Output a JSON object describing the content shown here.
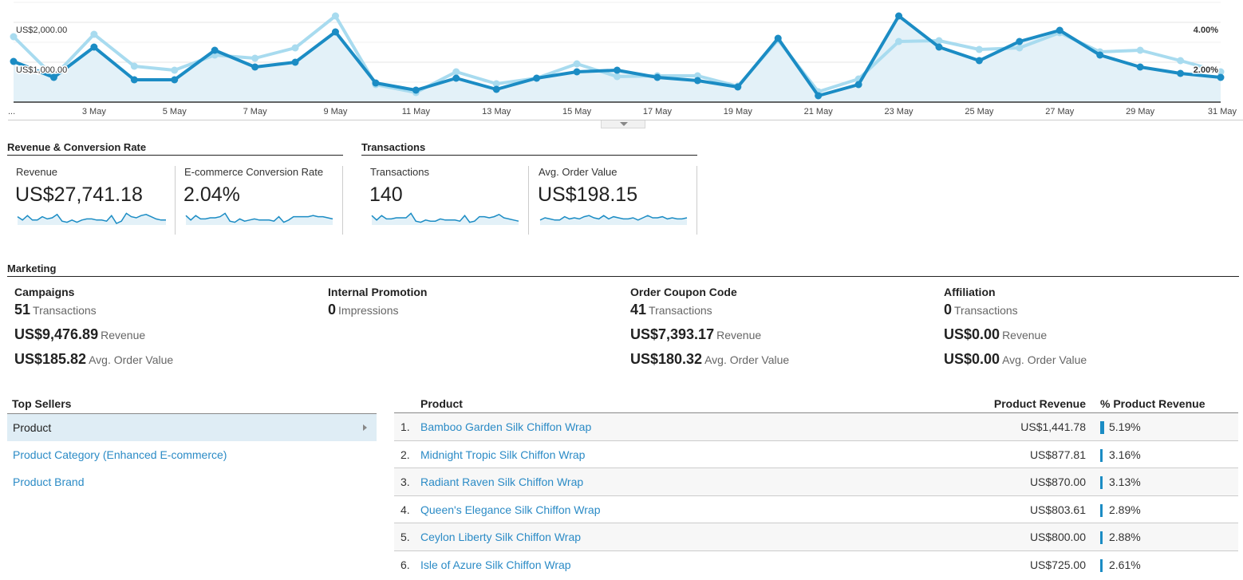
{
  "chart_data": {
    "type": "line",
    "title": "",
    "x": [
      "1 May",
      "2 May",
      "3 May",
      "4 May",
      "5 May",
      "6 May",
      "7 May",
      "8 May",
      "9 May",
      "10 May",
      "11 May",
      "12 May",
      "13 May",
      "14 May",
      "15 May",
      "16 May",
      "17 May",
      "18 May",
      "19 May",
      "20 May",
      "21 May",
      "22 May",
      "23 May",
      "24 May",
      "25 May",
      "26 May",
      "27 May",
      "28 May",
      "29 May",
      "30 May",
      "31 May"
    ],
    "x_tick_labels": [
      "...",
      "3 May",
      "5 May",
      "7 May",
      "9 May",
      "11 May",
      "13 May",
      "15 May",
      "17 May",
      "19 May",
      "21 May",
      "23 May",
      "25 May",
      "27 May",
      "29 May",
      "31 May"
    ],
    "series": [
      {
        "name": "Revenue",
        "axis": "left",
        "color": "#1b8cc4",
        "values": [
          1020,
          620,
          1380,
          560,
          560,
          1300,
          880,
          1000,
          1760,
          480,
          300,
          600,
          320,
          600,
          760,
          800,
          620,
          540,
          380,
          1600,
          160,
          440,
          2160,
          1380,
          1040,
          1520,
          1800,
          1180,
          880,
          720,
          620
        ]
      },
      {
        "name": "E-commerce Conversion Rate",
        "axis": "right",
        "color": "#a8dbef",
        "values": [
          3.28,
          1.28,
          3.4,
          1.8,
          1.6,
          2.36,
          2.2,
          2.72,
          4.32,
          0.88,
          0.48,
          1.52,
          0.92,
          1.2,
          1.92,
          1.28,
          1.32,
          1.32,
          0.8,
          3.12,
          0.52,
          1.16,
          3.04,
          3.08,
          2.64,
          2.72,
          3.48,
          2.52,
          2.6,
          2.08,
          1.52
        ]
      }
    ],
    "y_left": {
      "ticks": [
        "US$1,000.00",
        "US$2,000.00"
      ],
      "tick_values": [
        1000,
        2000
      ],
      "ylim": [
        0,
        2500
      ]
    },
    "y_right": {
      "ticks": [
        "2.00%",
        "4.00%"
      ],
      "tick_values": [
        2,
        4
      ],
      "ylim": [
        0,
        5
      ]
    },
    "grid": true,
    "legend": "none"
  },
  "sections": {
    "revenue_conversion": "Revenue & Conversion Rate",
    "transactions": "Transactions",
    "marketing": "Marketing",
    "top_sellers": "Top Sellers"
  },
  "metrics": [
    {
      "label": "Revenue",
      "value": "US$27,741.18",
      "spark": [
        6,
        3,
        7,
        3,
        3,
        6,
        4,
        5,
        8,
        2,
        1,
        3,
        1,
        3,
        4,
        4,
        3,
        3,
        2,
        7,
        0,
        2,
        9,
        6,
        5,
        7,
        8,
        6,
        4,
        3,
        3
      ]
    },
    {
      "label": "E-commerce Conversion Rate",
      "value": "2.04%",
      "spark": [
        7,
        3,
        7,
        4,
        4,
        5,
        5,
        6,
        9,
        2,
        1,
        4,
        2,
        3,
        4,
        3,
        3,
        3,
        2,
        6,
        1,
        3,
        6,
        6,
        6,
        6,
        7,
        6,
        6,
        5,
        4
      ]
    },
    {
      "label": "Transactions",
      "value": "140",
      "spark": [
        7,
        3,
        7,
        4,
        4,
        5,
        5,
        5,
        9,
        2,
        1,
        3,
        2,
        2,
        4,
        3,
        3,
        3,
        2,
        7,
        1,
        2,
        6,
        6,
        5,
        6,
        8,
        5,
        4,
        3,
        2
      ]
    },
    {
      "label": "Avg. Order Value",
      "value": "US$198.15",
      "spark": [
        3,
        5,
        4,
        3,
        3,
        6,
        4,
        5,
        4,
        6,
        7,
        5,
        4,
        7,
        4,
        6,
        5,
        4,
        4,
        5,
        3,
        5,
        7,
        5,
        5,
        6,
        4,
        5,
        4,
        4,
        5
      ]
    }
  ],
  "marketing": [
    {
      "title": "Campaigns",
      "rows": [
        {
          "value": "51",
          "label": "Transactions"
        },
        {
          "value": "US$9,476.89",
          "label": "Revenue"
        },
        {
          "value": "US$185.82",
          "label": "Avg. Order Value"
        }
      ]
    },
    {
      "title": "Internal Promotion",
      "rows": [
        {
          "value": "0",
          "label": "Impressions"
        }
      ]
    },
    {
      "title": "Order Coupon Code",
      "rows": [
        {
          "value": "41",
          "label": "Transactions"
        },
        {
          "value": "US$7,393.17",
          "label": "Revenue"
        },
        {
          "value": "US$180.32",
          "label": "Avg. Order Value"
        }
      ]
    },
    {
      "title": "Affiliation",
      "rows": [
        {
          "value": "0",
          "label": "Transactions"
        },
        {
          "value": "US$0.00",
          "label": "Revenue"
        },
        {
          "value": "US$0.00",
          "label": "Avg. Order Value"
        }
      ]
    }
  ],
  "top_sellers": {
    "items": [
      {
        "label": "Product",
        "active": true
      },
      {
        "label": "Product Category (Enhanced E-commerce)",
        "active": false
      },
      {
        "label": "Product Brand",
        "active": false
      }
    ]
  },
  "product_table": {
    "headers": {
      "product": "Product",
      "revenue": "Product Revenue",
      "pct": "% Product Revenue"
    },
    "bar_color": "#1b8cc4",
    "rows": [
      {
        "index": "1.",
        "name": "Bamboo Garden Silk Chiffon Wrap",
        "revenue": "US$1,441.78",
        "pct": "5.19%",
        "pct_value": 5.19
      },
      {
        "index": "2.",
        "name": "Midnight Tropic Silk Chiffon Wrap",
        "revenue": "US$877.81",
        "pct": "3.16%",
        "pct_value": 3.16
      },
      {
        "index": "3.",
        "name": "Radiant Raven Silk Chiffon Wrap",
        "revenue": "US$870.00",
        "pct": "3.13%",
        "pct_value": 3.13
      },
      {
        "index": "4.",
        "name": "Queen's Elegance Silk Chiffon Wrap",
        "revenue": "US$803.61",
        "pct": "2.89%",
        "pct_value": 2.89
      },
      {
        "index": "5.",
        "name": "Ceylon Liberty Silk Chiffon Wrap",
        "revenue": "US$800.00",
        "pct": "2.88%",
        "pct_value": 2.88
      },
      {
        "index": "6.",
        "name": "Isle of Azure Silk Chiffon Wrap",
        "revenue": "US$725.00",
        "pct": "2.61%",
        "pct_value": 2.61
      }
    ]
  }
}
